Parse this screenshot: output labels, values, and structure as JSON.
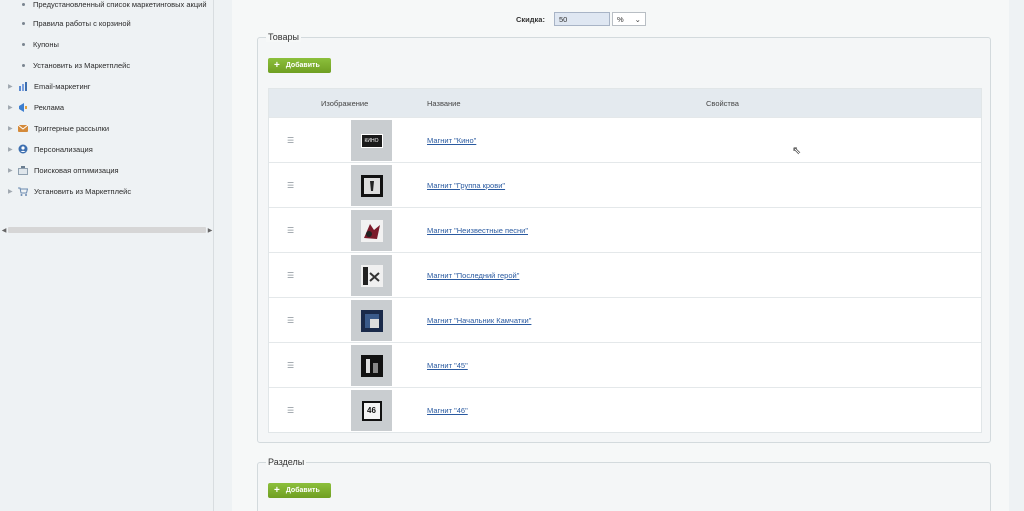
{
  "sidebar": {
    "sub_items": [
      {
        "label": "Предустановленный список маркетинговых акций"
      },
      {
        "label": "Правила работы с корзиной"
      },
      {
        "label": "Купоны"
      },
      {
        "label": "Установить из Маркетплейс"
      }
    ],
    "items": [
      {
        "label": "Email-маркетинг",
        "icon": "email-marketing-icon",
        "color": "#5b8ad0"
      },
      {
        "label": "Реклама",
        "icon": "advertising-icon",
        "color": "#3d7fd0"
      },
      {
        "label": "Триггерные рассылки",
        "icon": "trigger-mailing-icon",
        "color": "#d48a3a"
      },
      {
        "label": "Персонализация",
        "icon": "personalization-icon",
        "color": "#3d6fb0"
      },
      {
        "label": "Поисковая оптимизация",
        "icon": "seo-icon",
        "color": "#6a7d90"
      },
      {
        "label": "Установить из Маркетплейс",
        "icon": "marketplace-cart-icon",
        "color": "#6a8ab0"
      }
    ]
  },
  "discount": {
    "label": "Скидка:",
    "value": "50",
    "unit": "%"
  },
  "products": {
    "legend": "Товары",
    "add_label": "Добавить",
    "columns": {
      "image": "Изображение",
      "name": "Название",
      "props": "Свойства"
    },
    "rows": [
      {
        "name": "Магнит \"Кино\"",
        "cover_text": "КИНО"
      },
      {
        "name": "Магнит \"Группа крови\"",
        "cover_text": ""
      },
      {
        "name": "Магнит \"Неизвестные песни\"",
        "cover_text": ""
      },
      {
        "name": "Магнит \"Последний герой\"",
        "cover_text": ""
      },
      {
        "name": "Магнит \"Начальник Камчатки\"",
        "cover_text": ""
      },
      {
        "name": "Магнит \"45\"",
        "cover_text": ""
      },
      {
        "name": "Магнит \"46\"",
        "cover_text": "46"
      }
    ]
  },
  "sections": {
    "legend": "Разделы",
    "add_label": "Добавить"
  }
}
